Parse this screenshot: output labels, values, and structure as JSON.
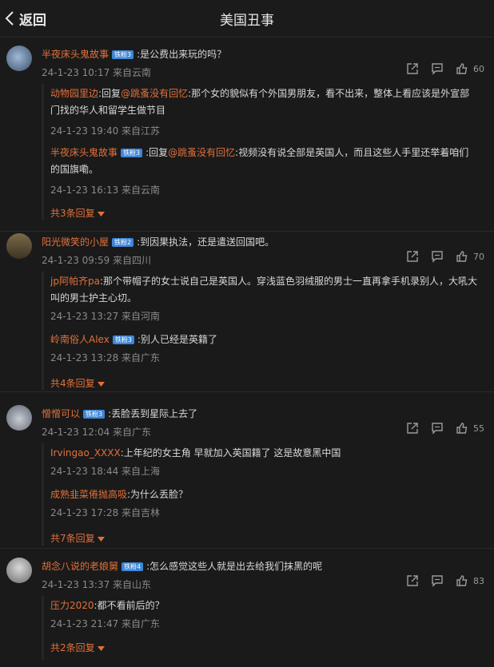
{
  "header": {
    "back_label": "返回",
    "title": "美国丑事"
  },
  "comments": [
    {
      "user": "半夜床头鬼故事",
      "level": "铁粉3",
      "text": ":是公费出来玩的吗？",
      "meta": "24-1-23 10:17 来自云南",
      "likes": "60",
      "replies": [
        {
          "user": "动物园里边",
          "pre": ":回复",
          "at": "@跳蚤没有回忆",
          "text": ":那个女的貌似有个外国男朋友，看不出来，整体上看应该是外宣部门找的华人和留学生做节目",
          "meta": "24-1-23 19:40 来自江苏"
        },
        {
          "user": "半夜床头鬼故事",
          "level": "铁粉3",
          "pre": ":回复",
          "at": "@跳蚤没有回忆",
          "text": ":视频没有说全部是英国人，而且这些人手里还举着咱们的国旗嘞。",
          "meta": "24-1-23 16:13 来自云南"
        }
      ],
      "more": "共3条回复"
    },
    {
      "user": "阳光微笑的小屋",
      "level": "铁粉2",
      "text": ":到因果执法，还是遣送回国吧。",
      "meta": "24-1-23 09:59 来自四川",
      "likes": "70",
      "replies": [
        {
          "user": "jp阿帕齐pa",
          "text": ":那个带帽子的女士说自己是英国人。穿浅蓝色羽绒服的男士一直再拿手机录别人，大吼大叫的男士护主心切。",
          "meta": "24-1-23 13:27 来自河南"
        },
        {
          "user": "岭南俗人Alex",
          "level": "铁粉3",
          "text": ":别人已经是英籍了",
          "meta": "24-1-23 13:28 来自广东"
        }
      ],
      "more": "共4条回复"
    },
    {
      "user": "憎憎可以",
      "level": "铁粉3",
      "text": ":丢脸丢到星际上去了",
      "meta": "24-1-23 12:04 来自广东",
      "likes": "55",
      "replies": [
        {
          "user": "Irvingao_XXXX",
          "text": ":上年纪的女主角 早就加入英国籍了 这是故意黑中国",
          "meta": "24-1-23 18:44 来自上海"
        },
        {
          "user": "成熟韭菜倦抛高吸",
          "text": ":为什么丢脸？",
          "meta": "24-1-23 17:28 来自吉林"
        }
      ],
      "more": "共7条回复"
    },
    {
      "user": "胡念八说的老娘舅",
      "level": "铁粉4",
      "text": ":怎么感觉这些人就是出去给我们抹黑的呢",
      "meta": "24-1-23 13:37 来自山东",
      "likes": "83",
      "replies": [
        {
          "user": "压力2020",
          "text": ":都不看前后的？",
          "meta": "24-1-23 21:47 来自广东"
        }
      ],
      "more": "共2条回复"
    }
  ],
  "icons": {
    "back": "chevron-left-icon",
    "share": "share-icon",
    "comment": "comment-icon",
    "like": "thumbs-up-icon",
    "more": "caret-down-icon"
  },
  "colors": {
    "accent": "#e2703a",
    "badge": "#3f86d6",
    "background": "#1a1a1a"
  }
}
